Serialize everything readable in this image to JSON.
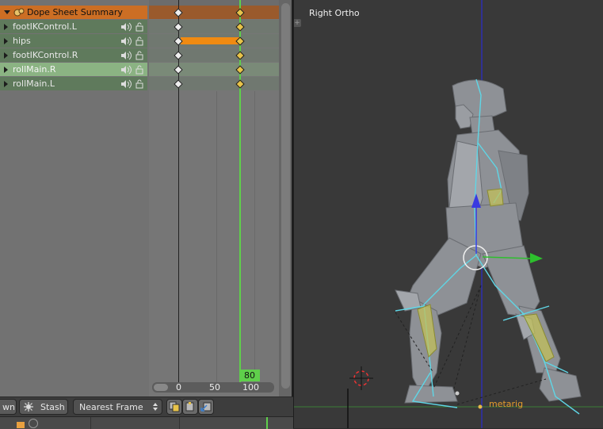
{
  "dopesheet": {
    "summary_label": "Dope Sheet Summary",
    "channels": [
      {
        "label": "footIKControl.L",
        "selected": false
      },
      {
        "label": "hips",
        "selected": false
      },
      {
        "label": "footIKControl.R",
        "selected": false
      },
      {
        "label": "rollMain.R",
        "selected": true
      },
      {
        "label": "rollMain.L",
        "selected": false
      }
    ],
    "current_frame": "80",
    "ruler": {
      "tick_0": "0",
      "tick_50": "50",
      "tick_100": "100"
    }
  },
  "header": {
    "partial_label": "wn",
    "stash_label": "Stash",
    "interpolation_value": "Nearest Frame"
  },
  "viewport": {
    "view_label": "Right Ortho",
    "object_label": "metarig"
  },
  "colors": {
    "summary_row": "#cc6e24",
    "channel_row": "#5f7a5c",
    "selected_row": "#8bb383",
    "playhead": "#5fcf4b",
    "bone": "#5fd6e6",
    "object_name": "#e59b2c"
  }
}
